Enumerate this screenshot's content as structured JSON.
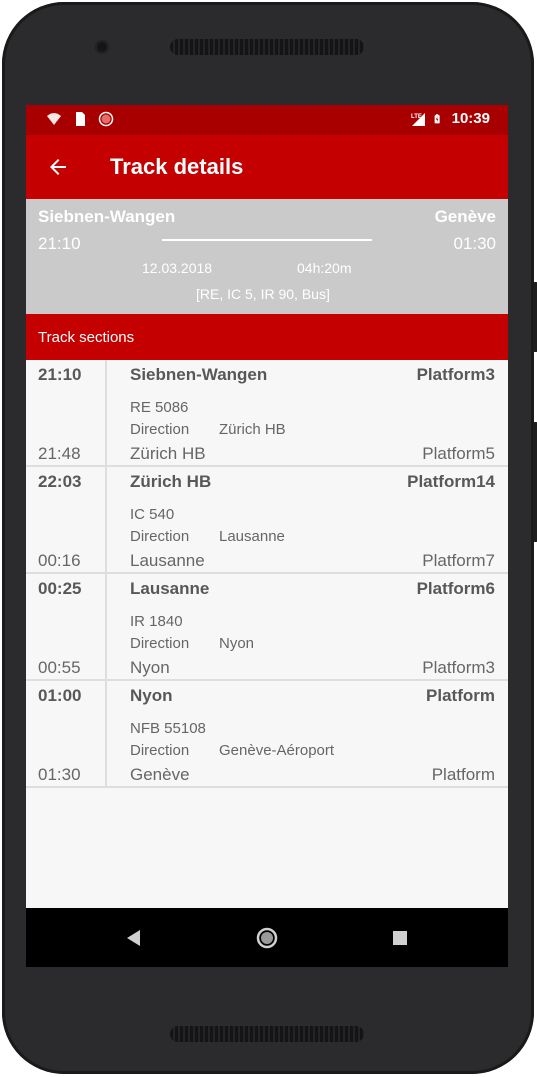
{
  "status_bar": {
    "time": "10:39",
    "network_label": "LTE",
    "icons": [
      "wifi-icon",
      "sim-card-icon",
      "record-icon",
      "signal-icon",
      "battery-charging-icon"
    ]
  },
  "app_bar": {
    "title": "Track details",
    "back_icon": "arrow-left-icon"
  },
  "summary": {
    "from": "Siebnen-Wangen",
    "to": "Genève",
    "departure": "21:10",
    "arrival": "01:30",
    "date": "12.03.2018",
    "duration": "04h:20m",
    "products": "[RE, IC 5, IR 90, Bus]"
  },
  "sections_header": "Track sections",
  "direction_label": "Direction",
  "sections": [
    {
      "dep_time": "21:10",
      "dep_station": "Siebnen-Wangen",
      "dep_platform": "Platform3",
      "train": "RE 5086",
      "direction": "Zürich HB",
      "arr_time": "21:48",
      "arr_station": "Zürich HB",
      "arr_platform": "Platform5"
    },
    {
      "dep_time": "22:03",
      "dep_station": "Zürich HB",
      "dep_platform": "Platform14",
      "train": "IC 540",
      "direction": "Lausanne",
      "arr_time": "00:16",
      "arr_station": "Lausanne",
      "arr_platform": "Platform7"
    },
    {
      "dep_time": "00:25",
      "dep_station": "Lausanne",
      "dep_platform": "Platform6",
      "train": "IR 1840",
      "direction": "Nyon",
      "arr_time": "00:55",
      "arr_station": "Nyon",
      "arr_platform": "Platform3"
    },
    {
      "dep_time": "01:00",
      "dep_station": "Nyon",
      "dep_platform": "Platform",
      "train": "NFB 55108",
      "direction": "Genève-Aéroport",
      "arr_time": "01:30",
      "arr_station": "Genève",
      "arr_platform": "Platform"
    }
  ],
  "nav_bar": {
    "icons": [
      "back-triangle-icon",
      "home-circle-icon",
      "recents-square-icon"
    ]
  },
  "colors": {
    "status_bar": "#a80000",
    "primary": "#c40000",
    "summary_bg": "#cacaca",
    "phone_frame": "#2b2b2d"
  }
}
